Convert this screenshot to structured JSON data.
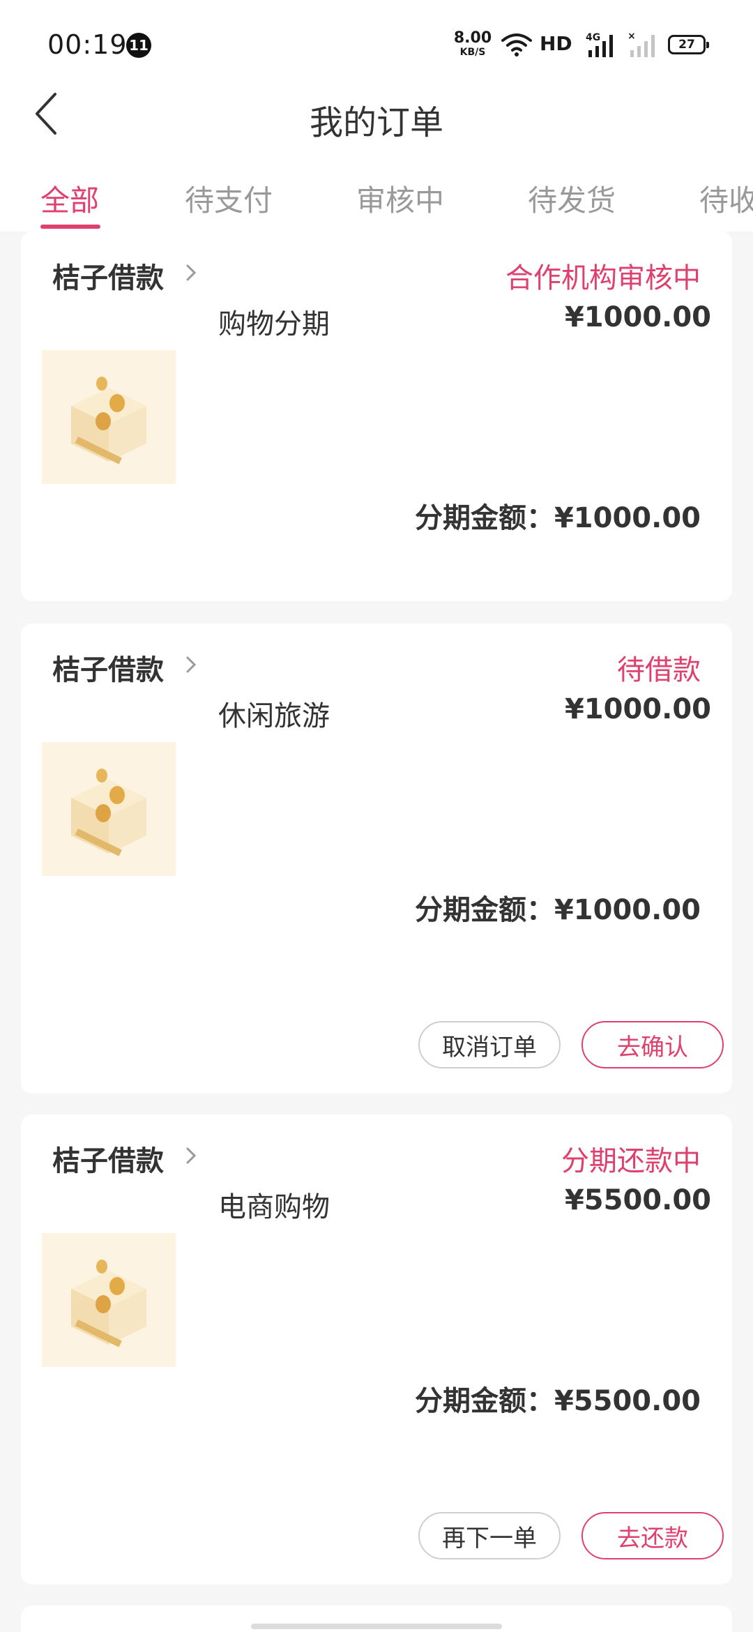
{
  "status_bar": {
    "time": "00:19",
    "notification_count": "11",
    "net_speed_value": "8.00",
    "net_speed_unit": "KB/S",
    "hd_label": "HD",
    "battery": "27"
  },
  "header": {
    "title": "我的订单"
  },
  "tabs": [
    {
      "label": "全部",
      "active": true
    },
    {
      "label": "待支付",
      "active": false
    },
    {
      "label": "审核中",
      "active": false
    },
    {
      "label": "待发货",
      "active": false
    },
    {
      "label": "待收",
      "active": false
    }
  ],
  "orders": [
    {
      "merchant": "桔子借款",
      "status": "合作机构审核中",
      "product": "购物分期",
      "price": "¥1000.00",
      "installment": "分期金额：¥1000.00"
    },
    {
      "merchant": "桔子借款",
      "status": "待借款",
      "product": "休闲旅游",
      "price": "¥1000.00",
      "installment": "分期金额：¥1000.00",
      "buttons": [
        "取消订单",
        "去确认"
      ]
    },
    {
      "merchant": "桔子借款",
      "status": "分期还款中",
      "product": "电商购物",
      "price": "¥5500.00",
      "installment": "分期金额：¥5500.00",
      "buttons": [
        "再下一单",
        "去还款"
      ]
    }
  ],
  "colors": {
    "accent": "#e0406d",
    "background": "#f6f6f6",
    "text": "#333333",
    "tab_inactive": "#999999"
  }
}
